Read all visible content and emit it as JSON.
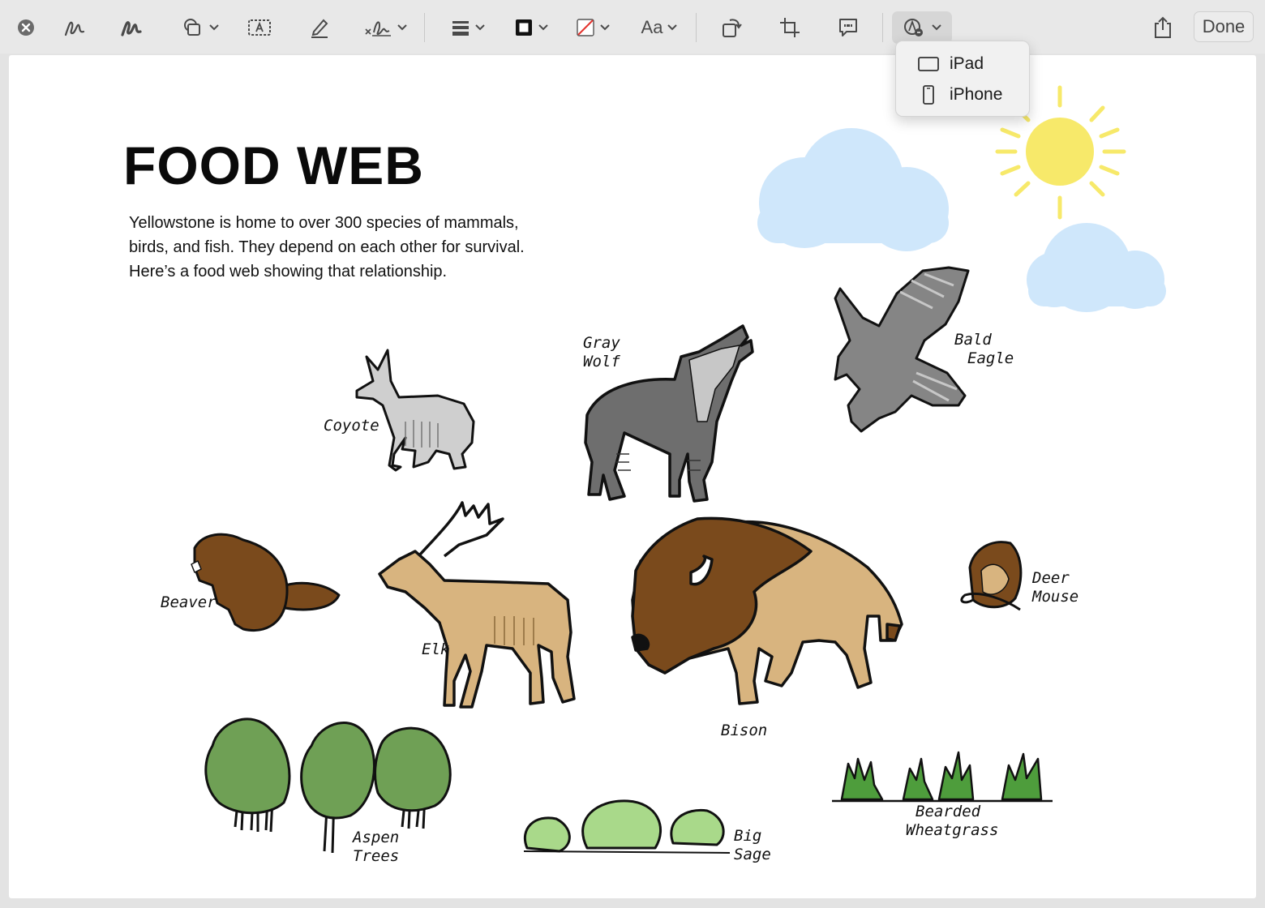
{
  "toolbar": {
    "done_label": "Done",
    "font_button_label": "Aa",
    "icons": [
      "close-icon",
      "sketch-icon",
      "draw-icon",
      "shapes-icon",
      "text-box-icon",
      "highlight-icon",
      "signature-icon",
      "line-style-icon",
      "border-color-icon",
      "fill-color-icon",
      "text-style-icon",
      "rotate-icon",
      "crop-icon",
      "description-icon",
      "annotate-with-device-icon",
      "share-icon"
    ]
  },
  "menu": {
    "items": [
      {
        "label": "iPad",
        "icon": "ipad-icon"
      },
      {
        "label": "iPhone",
        "icon": "iphone-icon"
      }
    ]
  },
  "document": {
    "title": "FOOD WEB",
    "description": [
      "Yellowstone is home to over 300 species of mammals,",
      "birds, and fish. They depend on each other for survival.",
      "Here’s a food web showing that relationship."
    ],
    "labels": {
      "gray_wolf": [
        "Gray",
        "Wolf"
      ],
      "coyote": "Coyote",
      "bald_eagle": [
        "Bald",
        "Eagle"
      ],
      "beaver": "Beaver",
      "elk": "Elk",
      "bison": "Bison",
      "deer_mouse": [
        "Deer",
        "Mouse"
      ],
      "aspen_trees": [
        "Aspen",
        "Trees"
      ],
      "big_sage": [
        "Big",
        "Sage"
      ],
      "bearded_wheatgrass": [
        "Bearded",
        "Wheatgrass"
      ]
    }
  },
  "colors": {
    "cloud": "#cfe7fb",
    "sun": "#f7e96a",
    "wolf": "#6e6e6e",
    "coyote": "#cfcfcf",
    "eagle": "#858585",
    "brown": "#7a4a1c",
    "tan": "#d8b47f",
    "tree_green": "#6fa055",
    "sage": "#a9d98a"
  }
}
